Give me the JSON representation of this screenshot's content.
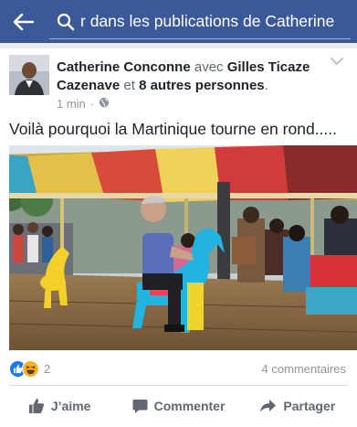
{
  "search": {
    "query": "Rechercher dans les publications de Catherine",
    "visible_text": "r dans les publications de Catherine"
  },
  "post": {
    "author": "Catherine Conconne",
    "with_word": "avec",
    "tagged_person": "Gilles Ticaze Cazenave",
    "and_word": "et",
    "others": "8 autres personnes",
    "period": ".",
    "time": "1 min",
    "separator": "·",
    "text": "Voilà pourquoi la Martinique tourne en rond....."
  },
  "footer": {
    "reaction_count": "2",
    "comments": "4 commentaires",
    "like_label": "J’aime",
    "comment_label": "Commenter",
    "share_label": "Partager"
  },
  "colors": {
    "brand": "#3b5998",
    "like_blue": "#1877f2",
    "haha_yellow": "#f7b125",
    "muted": "#90949c"
  },
  "icons": [
    "back-arrow-icon",
    "search-icon",
    "globe-icon",
    "chevron-down-icon",
    "like-reaction-icon",
    "haha-reaction-icon",
    "thumbs-up-icon",
    "comment-icon",
    "share-icon"
  ]
}
